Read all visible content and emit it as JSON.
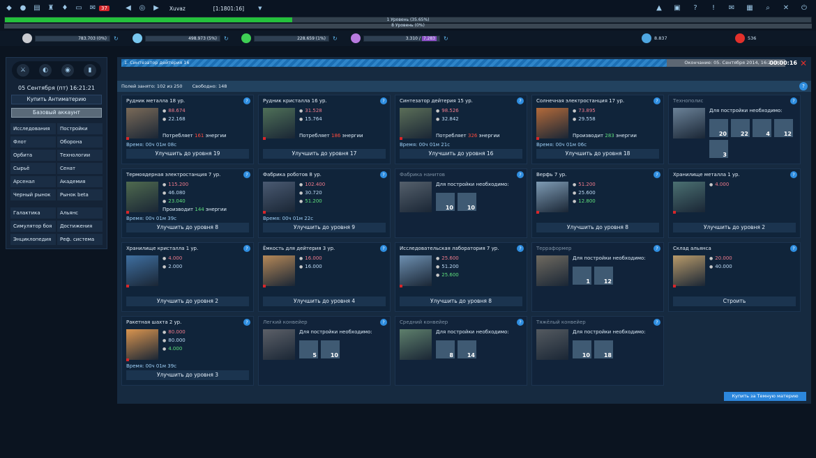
{
  "top": {
    "mail_badge": "37",
    "player": "Xuvaz",
    "coords": "[1:1801:16]"
  },
  "xp": {
    "level1": "1 Уровень (35.65%)",
    "level1_pct": 35.65,
    "level2": "8 Уровень (0%)"
  },
  "resources": [
    {
      "name": "metal",
      "value": "783.703 (0%)",
      "color": "#c9cbd0"
    },
    {
      "name": "crystal",
      "value": "498.973 (5%)",
      "color": "#78c7ef"
    },
    {
      "name": "deuterium",
      "value": "228.659 (1%)",
      "color": "#3fcf55"
    },
    {
      "name": "energy",
      "value": "3.310",
      "extra": "7.283",
      "color": "#b87be0"
    },
    {
      "name": "dark-matter",
      "value": "8.837",
      "color": "#4ea6e0"
    },
    {
      "name": "antimatter",
      "value": "536",
      "color": "#e2302b"
    }
  ],
  "sidebar": {
    "date": "05 Сентября (пт) 16:21:21",
    "buy_label": "Купить Антиматерию",
    "account_label": "Базовый аккаунт",
    "menu": [
      "Исследования",
      "Постройки",
      "Флот",
      "Оборона",
      "Орбита",
      "Технологии",
      "Сырьё",
      "Сенат",
      "Арсенал",
      "Академия",
      "Черный рынок",
      "Рынок beta",
      "Галактика",
      "Альянс",
      "Симулятор боя",
      "Достижения",
      "Энциклопедия",
      "Реф. система"
    ]
  },
  "build": {
    "queue": "1. Синтезатор дейтерия 16",
    "ends": "Окончание: 05. Сентября 2014, 16:21:37",
    "timer": "00:00:16"
  },
  "fields": {
    "used": "Полей занято: 102 из 250",
    "free": "Свободно: 148"
  },
  "cards": [
    {
      "title": "Рудник металла 18 ур.",
      "r1": "88.674",
      "r2": "22.168",
      "energy": "Потребляет ",
      "ev": "161",
      "eu": " энергии",
      "time": "Время: 00ч 01м 08с",
      "btn": "Улучшить до уровня 19"
    },
    {
      "title": "Рудник кристалла 16 ур.",
      "r1": "31.528",
      "r2": "15.764",
      "energy": "Потребляет ",
      "ev": "186",
      "eu": " энергии",
      "time": "",
      "btn": "Улучшить до уровня 17"
    },
    {
      "title": "Синтезатор дейтерия 15 ур.",
      "r1": "98.526",
      "r2": "32.842",
      "energy": "Потребляет ",
      "ev": "326",
      "eu": " энергии",
      "time": "Время: 00ч 01м 21с",
      "btn": "Улучшить до уровня 16"
    },
    {
      "title": "Солнечная электростанция 17 ур.",
      "r1": "73.895",
      "r2": "29.558",
      "energy": "Производит ",
      "ev": "283",
      "eu": " энергии",
      "time": "Время: 00ч 01м 06с",
      "btn": "Улучшить до уровня 18"
    },
    {
      "title": "Технополис",
      "need": "Для постройки необходимо:",
      "reqs": [
        "20",
        "22",
        "4",
        "12",
        "3"
      ],
      "locked": true
    },
    {
      "title": "Термоядерная электростанция 7 ур.",
      "r1": "115.200",
      "r2": "46.080",
      "r3": "23.040",
      "energy": "Производит ",
      "ev": "144",
      "eu": " энергии",
      "time": "Время: 00ч 01м 39с",
      "btn": "Улучшить до уровня 8"
    },
    {
      "title": "Фабрика роботов 8 ур.",
      "r1": "102.400",
      "r2": "30.720",
      "r3": "51.200",
      "time": "Время: 00ч 01м 22с",
      "btn": "Улучшить до уровня 9"
    },
    {
      "title": "Фабрика нанитов",
      "need": "Для постройки необходимо:",
      "reqs": [
        "10",
        "10"
      ],
      "locked": true
    },
    {
      "title": "Верфь 7 ур.",
      "r1": "51.200",
      "r2": "25.600",
      "r3": "12.800",
      "btn": "Улучшить до уровня 8"
    },
    {
      "title": "Хранилище металла 1 ур.",
      "r1": "4.000",
      "btn": "Улучшить до уровня 2"
    },
    {
      "title": "Хранилище кристалла 1 ур.",
      "r1": "4.000",
      "r2": "2.000",
      "btn": "Улучшить до уровня 2"
    },
    {
      "title": "Ёмкость для дейтерия 3 ур.",
      "r1": "16.000",
      "r2": "16.000",
      "btn": "Улучшить до уровня 4"
    },
    {
      "title": "Исследовательская лаборатория 7 ур.",
      "r1": "25.600",
      "r2": "51.200",
      "r3": "25.600",
      "btn": "Улучшить до уровня 8"
    },
    {
      "title": "Терраформер",
      "need": "Для постройки необходимо:",
      "reqs": [
        "1",
        "12"
      ],
      "locked": true
    },
    {
      "title": "Склад альянса",
      "r1": "20.000",
      "r2": "40.000",
      "btn": "Строить"
    },
    {
      "title": "Ракетная шахта 2 ур.",
      "r1": "80.000",
      "r2": "80.000",
      "r3": "4.000",
      "time": "Время: 00ч 01м 39с",
      "btn": "Улучшить до уровня 3"
    },
    {
      "title": "Легкий конвейер",
      "need": "Для постройки необходимо:",
      "reqs": [
        "5",
        "10"
      ],
      "locked": true
    },
    {
      "title": "Средний конвейер",
      "need": "Для постройки необходимо:",
      "reqs": [
        "8",
        "14"
      ],
      "locked": true
    },
    {
      "title": "Тяжёлый конвейер",
      "need": "Для постройки необходимо:",
      "reqs": [
        "10",
        "18"
      ],
      "locked": true
    }
  ],
  "buy_dm": "Купить за Темную материю"
}
